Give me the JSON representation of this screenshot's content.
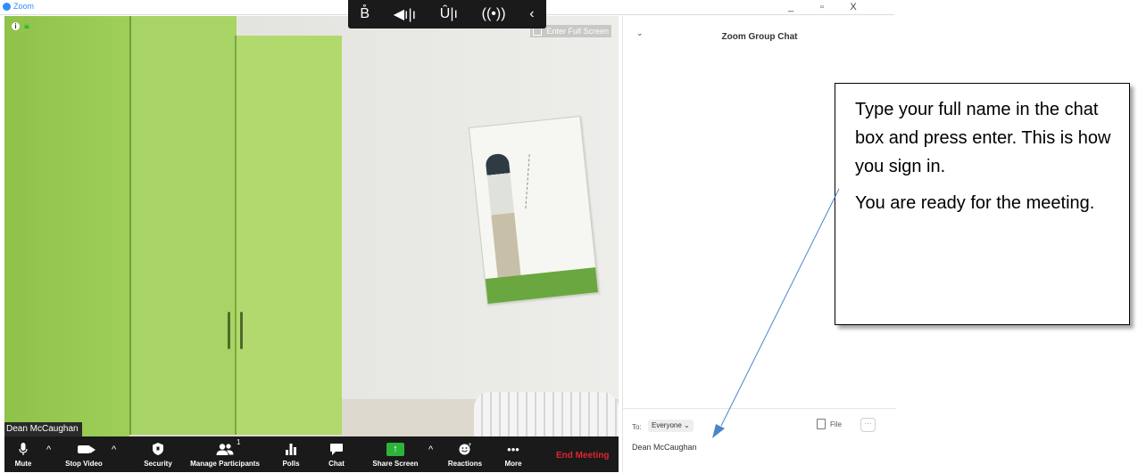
{
  "window": {
    "app_title": "Zoom",
    "minimize": "_",
    "restore": "▫",
    "close": "X"
  },
  "floating_bar": {
    "audio_icons": [
      "transcript-icon",
      "speaker-icon",
      "mic-icon",
      "broadcast-icon",
      "chevron-left-icon"
    ],
    "glyphs": [
      "B̊",
      "◀ı|ı",
      "Ȗ|ı",
      "((•))",
      "‹"
    ]
  },
  "video": {
    "fullscreen_label": "Enter Full Screen",
    "participant_name": "Dean McCaughan"
  },
  "toolbar": {
    "buttons": [
      {
        "label": "Mute",
        "icon": "mic-icon"
      },
      {
        "label": "Stop Video",
        "icon": "video-camera-icon"
      },
      {
        "label": "Security",
        "icon": "shield-icon"
      },
      {
        "label": "Manage Participants",
        "icon": "participants-icon",
        "count": "1"
      },
      {
        "label": "Polls",
        "icon": "polls-icon"
      },
      {
        "label": "Chat",
        "icon": "chat-icon"
      },
      {
        "label": "Share Screen",
        "icon": "share-screen-icon"
      },
      {
        "label": "Reactions",
        "icon": "reactions-icon"
      },
      {
        "label": "More",
        "icon": "ellipsis-icon"
      }
    ],
    "end_meeting": "End Meeting",
    "end_color": "#e0242d",
    "share_color": "#2eb33a"
  },
  "chat": {
    "collapse": "⌄",
    "title": "Zoom Group Chat",
    "to_label": "To:",
    "to_value": "Everyone ⌄",
    "file_label": "File",
    "more_label": "···",
    "input_value": "Dean McCaughan"
  },
  "callout": {
    "paragraph1": "Type your full name in the chat box and press enter. This is how you sign in.",
    "paragraph2": "You are ready for the meeting."
  },
  "colors": {
    "zoom_blue": "#2d8cff",
    "toolbar_bg": "#1a1a1a",
    "cabinet_green": "#9fcf58",
    "arrow_color": "#4a86c8"
  }
}
